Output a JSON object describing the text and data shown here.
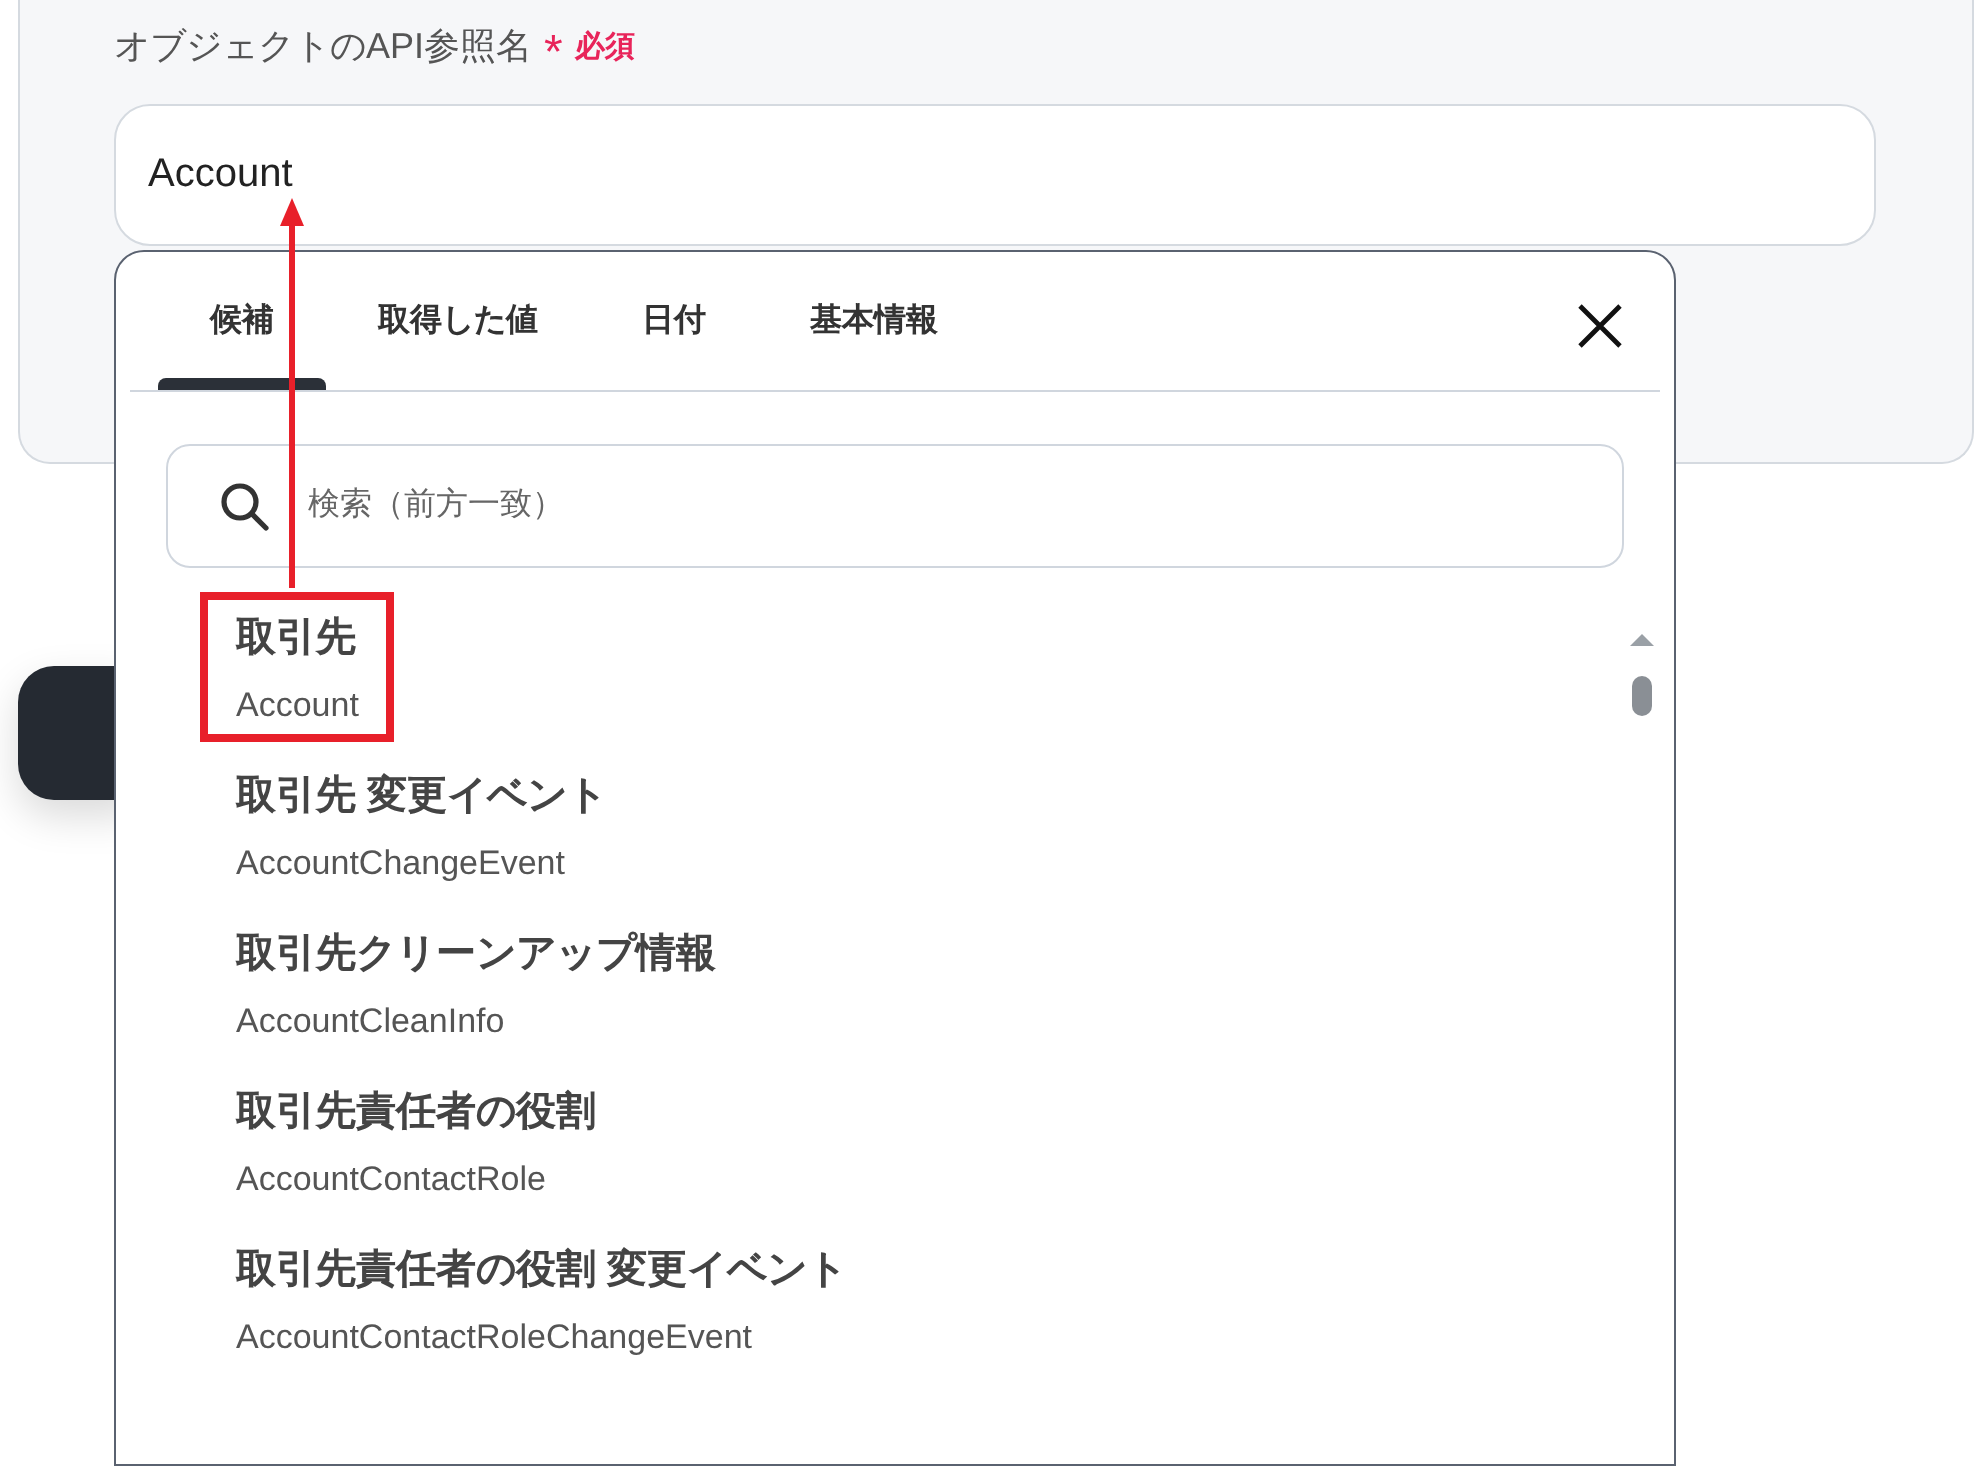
{
  "field": {
    "label": "オブジェクトのAPI参照名",
    "required_mark": "*",
    "required_text": "必須",
    "value": "Account"
  },
  "picker": {
    "tabs": [
      {
        "label": "候補",
        "selected": true
      },
      {
        "label": "取得した値",
        "selected": false
      },
      {
        "label": "日付",
        "selected": false
      },
      {
        "label": "基本情報",
        "selected": false
      }
    ],
    "search": {
      "placeholder": "検索（前方一致）"
    },
    "items": [
      {
        "title": "取引先",
        "api_name": "Account",
        "highlighted": true
      },
      {
        "title": "取引先 変更イベント",
        "api_name": "AccountChangeEvent",
        "highlighted": false
      },
      {
        "title": "取引先クリーンアップ情報",
        "api_name": "AccountCleanInfo",
        "highlighted": false
      },
      {
        "title": "取引先責任者の役割",
        "api_name": "AccountContactRole",
        "highlighted": false
      },
      {
        "title": "取引先責任者の役割 変更イベント",
        "api_name": "AccountContactRoleChangeEvent",
        "highlighted": false
      }
    ]
  }
}
